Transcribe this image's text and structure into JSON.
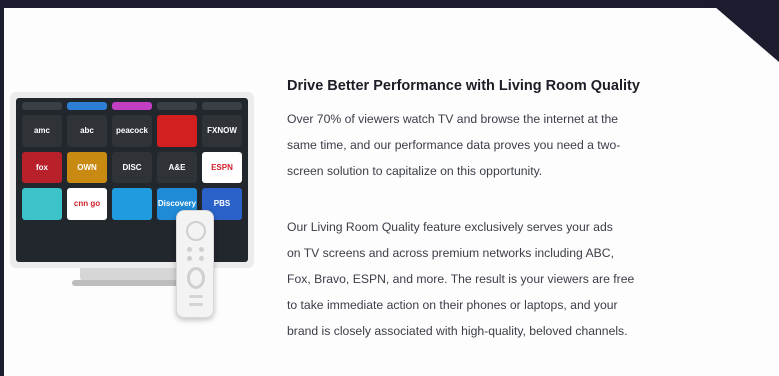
{
  "heading": "Drive Better Performance with Living Room Quality",
  "paragraph1": [
    "Over 70% of viewers watch TV and browse the internet at the",
    "same time, and our performance data proves you need a two-",
    "screen solution to capitalize on this opportunity."
  ],
  "paragraph2": [
    "Our Living Room Quality feature exclusively serves your ads",
    "on TV screens and across premium networks including ABC,",
    "Fox, Bravo, ESPN, and more. The result is your viewers are free",
    "to take immediate action on their phones or laptops, and your",
    "brand is closely associated with high-quality, beloved channels."
  ],
  "tv_tiles": [
    {
      "label": "",
      "bg": "#3a3f47"
    },
    {
      "label": "",
      "bg": "#2d7fd6"
    },
    {
      "label": "",
      "bg": "#c23fc4"
    },
    {
      "label": "",
      "bg": "#3a3f47"
    },
    {
      "label": "",
      "bg": "#3a3f47"
    },
    {
      "label": "amc",
      "bg": "#2f3338"
    },
    {
      "label": "abc",
      "bg": "#2f3338"
    },
    {
      "label": "peacock",
      "bg": "#2f3338"
    },
    {
      "label": "",
      "bg": "#d31f1f"
    },
    {
      "label": "FXNOW",
      "bg": "#2f3338"
    },
    {
      "label": "fox",
      "bg": "#b8202a"
    },
    {
      "label": "OWN",
      "bg": "#c98a12"
    },
    {
      "label": "DISC",
      "bg": "#2f3338"
    },
    {
      "label": "A&E",
      "bg": "#2f3338"
    },
    {
      "label": "ESPN",
      "bg": "#ffffff"
    },
    {
      "label": "",
      "bg": "#3cc3c9"
    },
    {
      "label": "cnn go",
      "bg": "#ffffff"
    },
    {
      "label": "",
      "bg": "#1f9be0"
    },
    {
      "label": "Discovery",
      "bg": "#1f8ad6"
    },
    {
      "label": "PBS",
      "bg": "#2a62c9"
    }
  ]
}
